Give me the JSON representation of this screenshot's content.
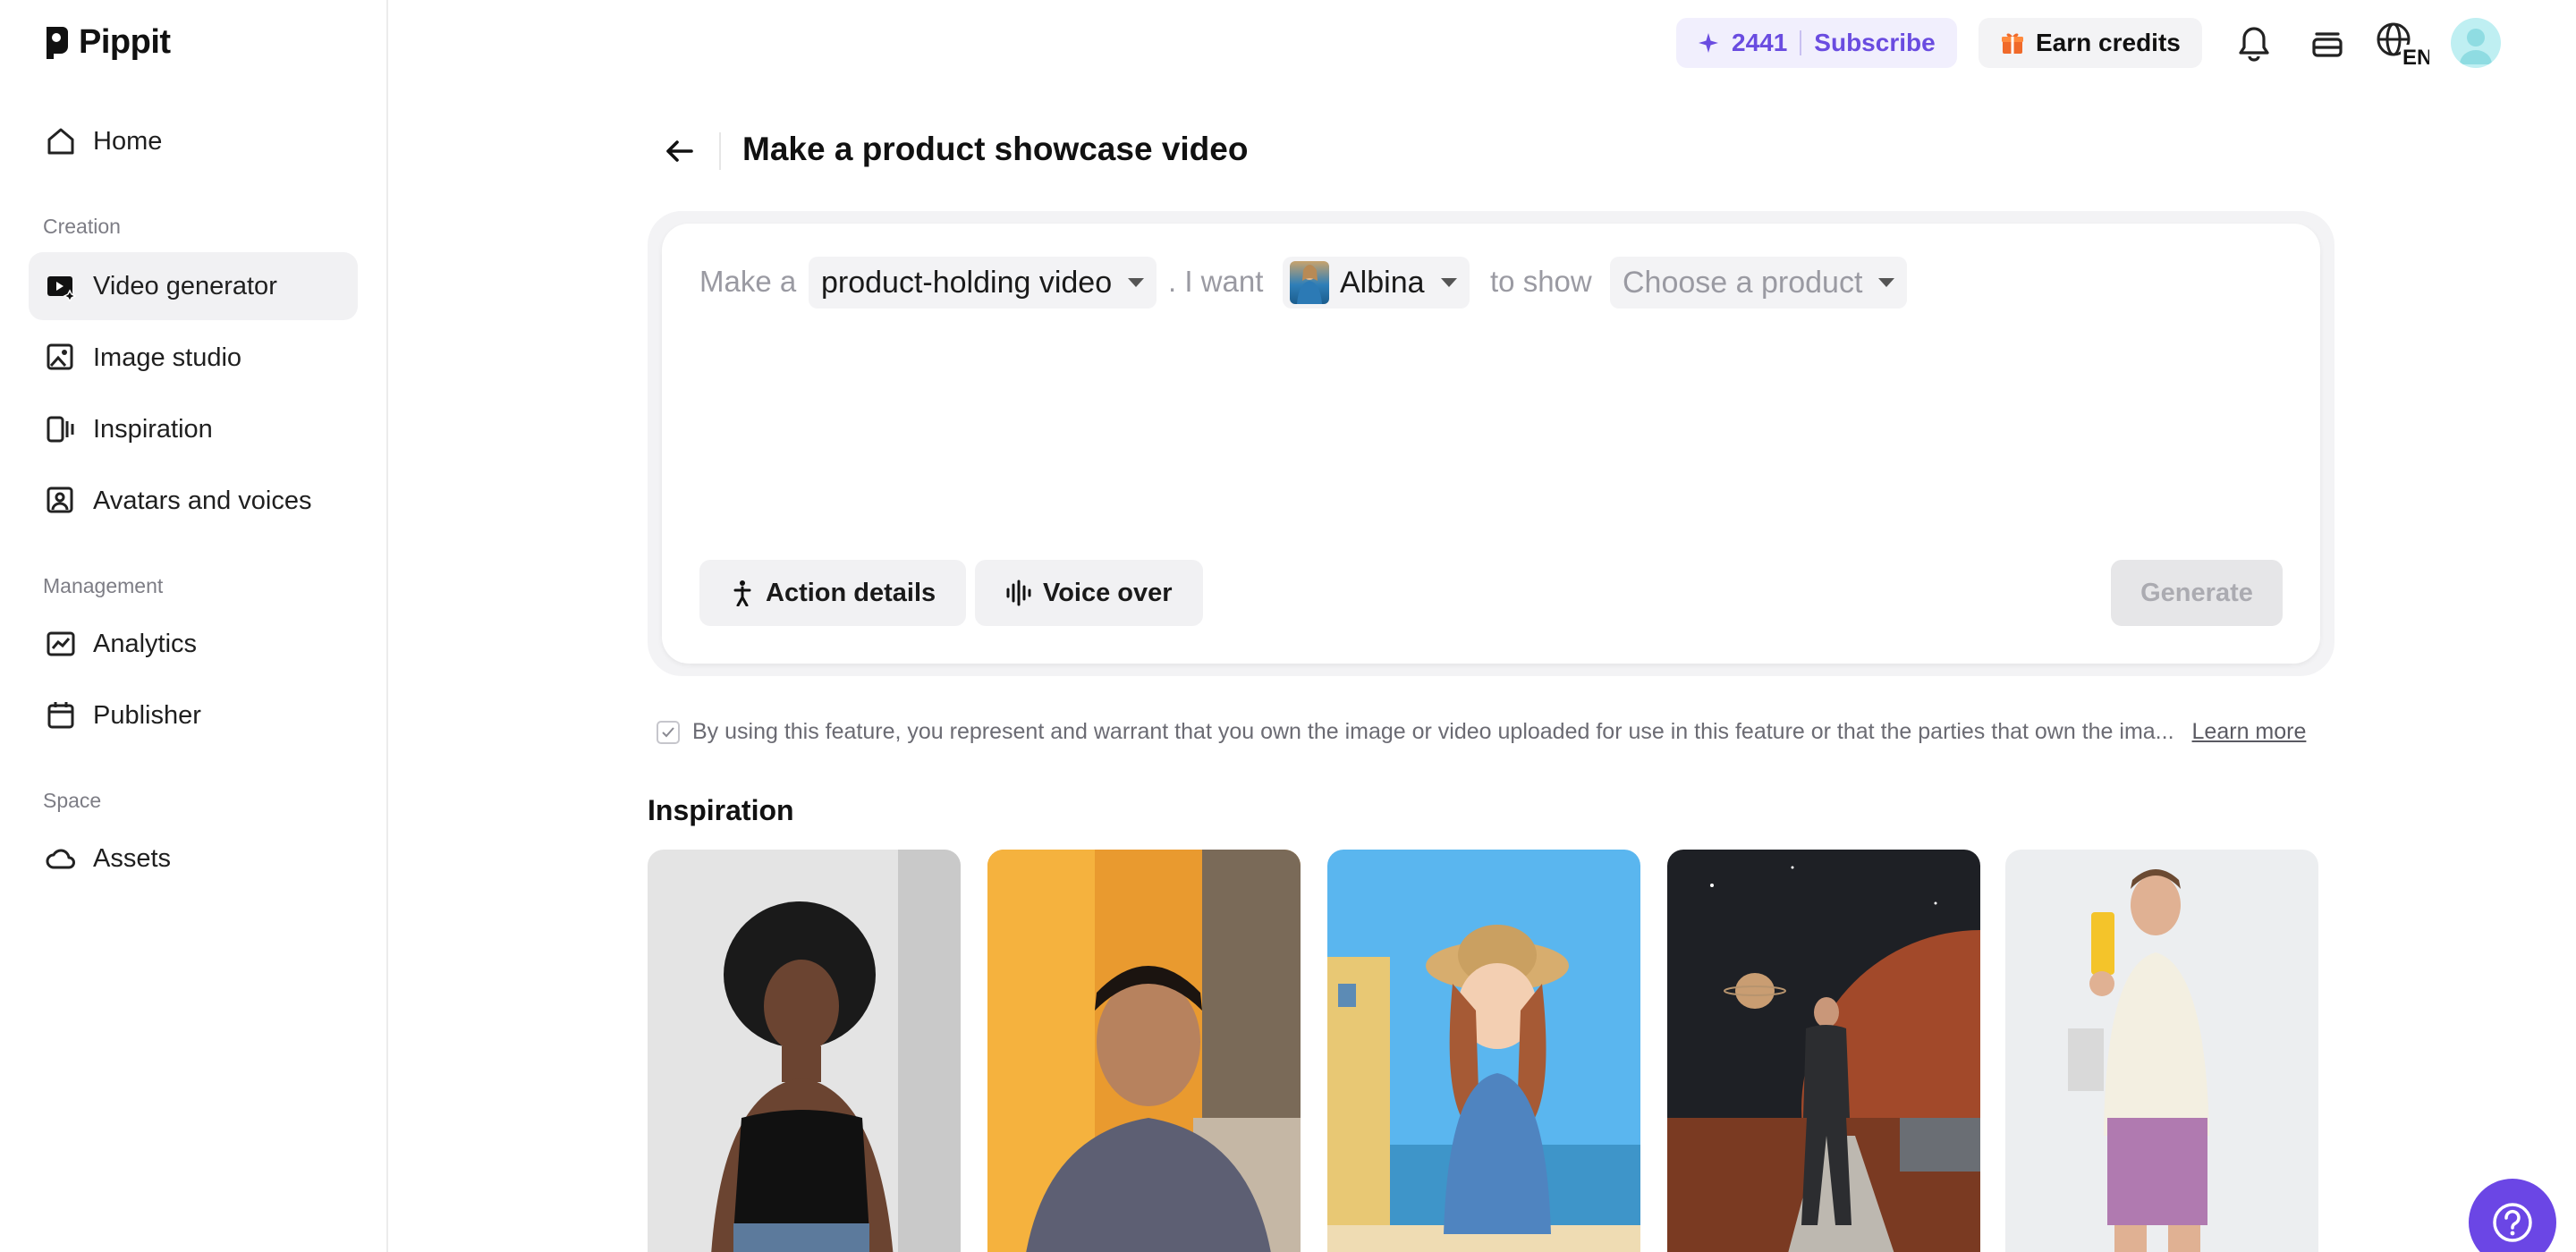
{
  "app": {
    "name": "Pippit"
  },
  "sidebar": {
    "home": "Home",
    "sections": {
      "creation": "Creation",
      "management": "Management",
      "space": "Space"
    },
    "items": [
      {
        "label": "Home",
        "icon": "home-icon"
      },
      {
        "label": "Video generator",
        "icon": "video-generator-icon",
        "active": true
      },
      {
        "label": "Image studio",
        "icon": "image-studio-icon"
      },
      {
        "label": "Inspiration",
        "icon": "inspiration-icon"
      },
      {
        "label": "Avatars and voices",
        "icon": "avatar-voice-icon"
      },
      {
        "label": "Analytics",
        "icon": "analytics-icon"
      },
      {
        "label": "Publisher",
        "icon": "calendar-icon"
      },
      {
        "label": "Assets",
        "icon": "cloud-icon"
      }
    ]
  },
  "topbar": {
    "credits": "2441",
    "subscribe": "Subscribe",
    "earn_credits": "Earn credits",
    "language": "EN"
  },
  "main": {
    "title": "Make a product showcase video",
    "composer": {
      "make_a": "Make a",
      "video_type": "product-holding video",
      "i_want": ". I want",
      "avatar_name": "Albina",
      "to_show": "to show",
      "product_placeholder": "Choose a product",
      "action_details": "Action details",
      "voice_over": "Voice over",
      "generate": "Generate"
    },
    "disclaimer": {
      "text": "By using this feature, you represent and warrant that you own the image or video uploaded for use in this feature or that the parties that own the ima...",
      "learn_more": "Learn more"
    },
    "inspiration": {
      "title": "Inspiration"
    }
  },
  "colors": {
    "accent": "#6a4ce0",
    "help": "#6b46e5"
  }
}
